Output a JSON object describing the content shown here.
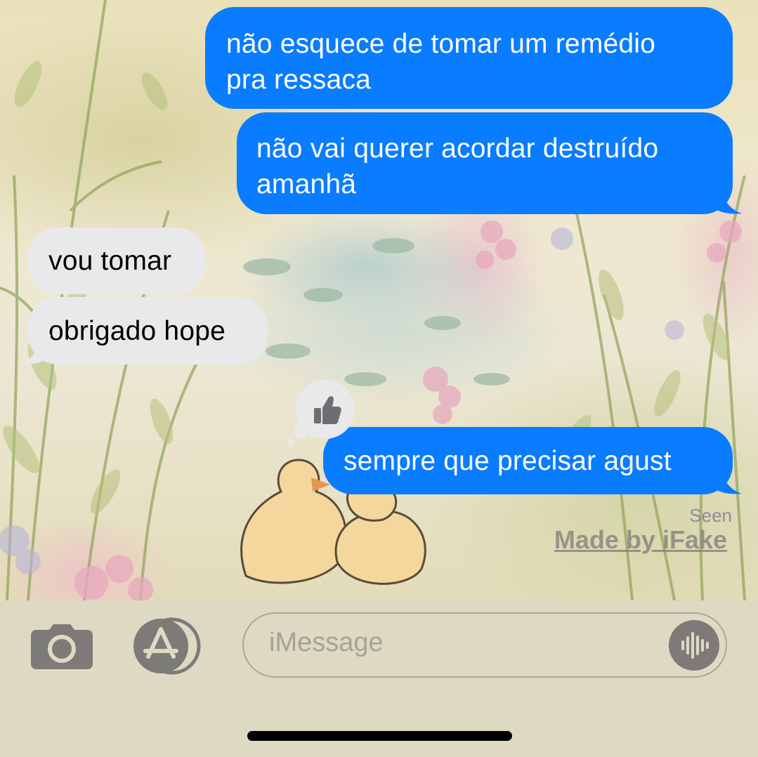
{
  "colors": {
    "sent_bubble": "#0a7cff",
    "received_bubble": "#e9e9eb",
    "input_bar": "#ded9c3"
  },
  "messages": [
    {
      "direction": "sent",
      "lines": [
        "não esquece de tomar um remédio",
        "pra ressaca"
      ]
    },
    {
      "direction": "sent",
      "lines": [
        "não vai querer acordar destruído",
        "amanhã"
      ]
    },
    {
      "direction": "received",
      "lines": [
        "vou tomar"
      ]
    },
    {
      "direction": "received",
      "lines": [
        "obrigado hope"
      ]
    },
    {
      "direction": "sent",
      "lines": [
        "sempre que precisar agust"
      ],
      "reaction": "thumbs-up-icon"
    }
  ],
  "status": {
    "seen": "Seen"
  },
  "watermark": "Made by iFake",
  "input": {
    "placeholder": "iMessage",
    "left_icons": [
      "camera-icon",
      "app-store-icon"
    ],
    "right_icon": "waveform-icon"
  }
}
